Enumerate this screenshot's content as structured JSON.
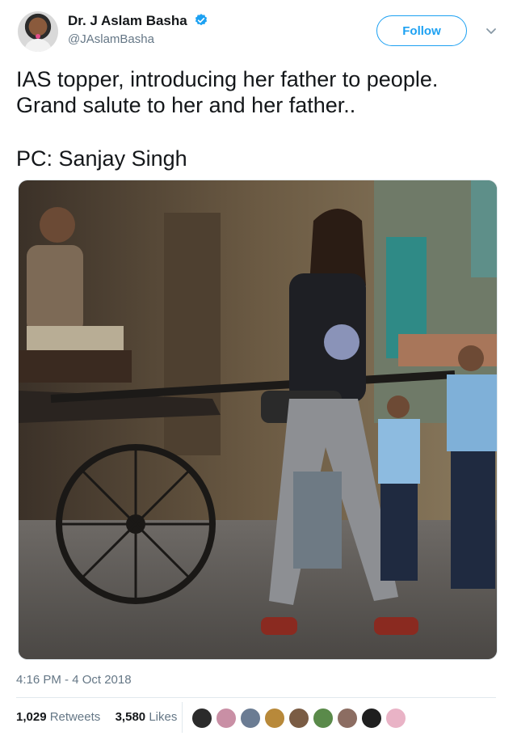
{
  "author": {
    "display_name": "Dr. J Aslam Basha",
    "handle": "@JAslamBasha",
    "verified": true
  },
  "follow_button": {
    "label": "Follow"
  },
  "tweet": {
    "text": "IAS topper, introducing her father to people.\nGrand salute to her and her father..",
    "pc_line": "PC: Sanjay Singh"
  },
  "timestamp": "4:16 PM - 4 Oct 2018",
  "stats": {
    "retweets_count": "1,029",
    "retweets_label": "Retweets",
    "likes_count": "3,580",
    "likes_label": "Likes"
  },
  "likers": [
    {
      "color": "#2b2b2b"
    },
    {
      "color": "#c98fa5"
    },
    {
      "color": "#6b7c93"
    },
    {
      "color": "#b8893a"
    },
    {
      "color": "#7a5c44"
    },
    {
      "color": "#5a8a4a"
    },
    {
      "color": "#8c6d62"
    },
    {
      "color": "#1f1f1f"
    },
    {
      "color": "#e9b3c6"
    }
  ],
  "colors": {
    "accent": "#1da1f2",
    "text": "#14171a",
    "muted": "#657786"
  }
}
